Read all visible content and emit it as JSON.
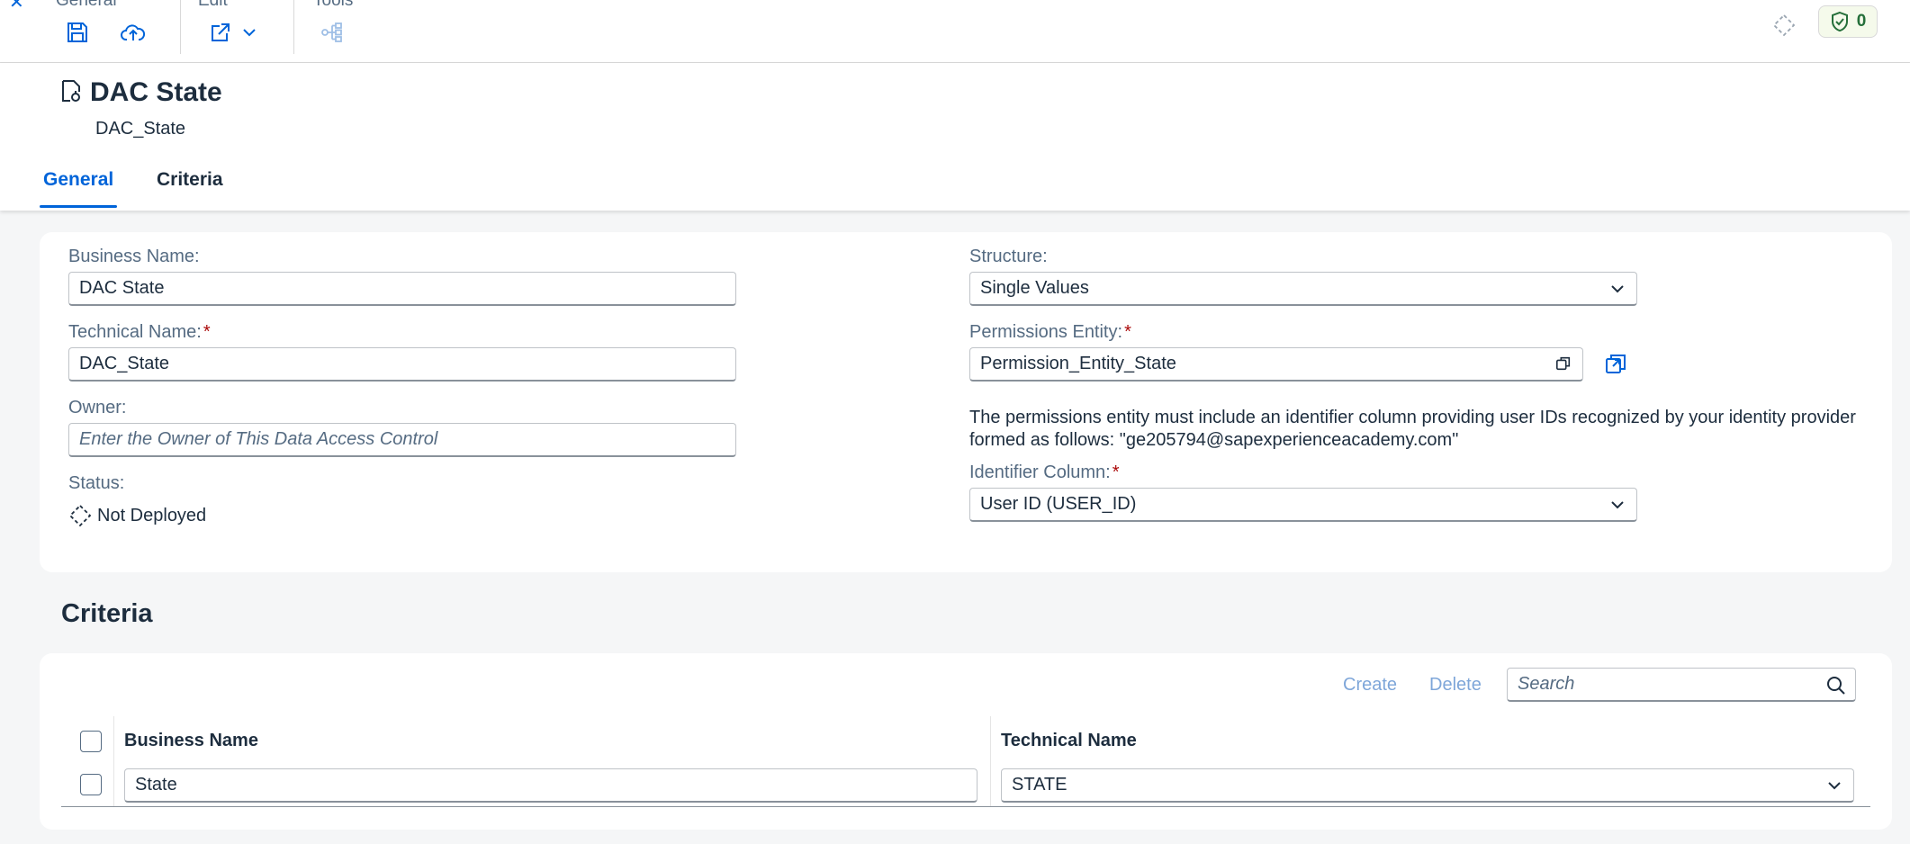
{
  "toolbar": {
    "groups": {
      "general": "General",
      "edit": "Edit",
      "tools": "Tools"
    },
    "shield_count": "0"
  },
  "header": {
    "title": "DAC State",
    "subtitle": "DAC_State",
    "tabs": [
      "General",
      "Criteria"
    ]
  },
  "general": {
    "business_name": {
      "label": "Business Name:",
      "value": "DAC State"
    },
    "technical_name": {
      "label": "Technical Name:",
      "required": "*",
      "value": "DAC_State"
    },
    "owner": {
      "label": "Owner:",
      "placeholder": "Enter the Owner of This Data Access Control"
    },
    "status": {
      "label": "Status:",
      "value": "Not Deployed"
    },
    "structure": {
      "label": "Structure:",
      "value": "Single Values"
    },
    "permissions_entity": {
      "label": "Permissions Entity:",
      "required": "*",
      "value": "Permission_Entity_State"
    },
    "info": "The permissions entity must include an identifier column providing user IDs recognized by your identity provider formed as follows: \"ge205794@sapexperienceacademy.com\"",
    "identifier_column": {
      "label": "Identifier Column:",
      "required": "*",
      "value": "User ID (USER_ID)"
    }
  },
  "criteria": {
    "section_title": "Criteria",
    "create_label": "Create",
    "delete_label": "Delete",
    "search_placeholder": "Search",
    "columns": [
      "Business Name",
      "Technical Name"
    ],
    "rows": [
      {
        "business_name": "State",
        "technical_name": "STATE"
      }
    ]
  },
  "colors": {
    "accent": "#0064d9",
    "required": "#aa0808",
    "disabled_link": "#7ea6d9"
  }
}
